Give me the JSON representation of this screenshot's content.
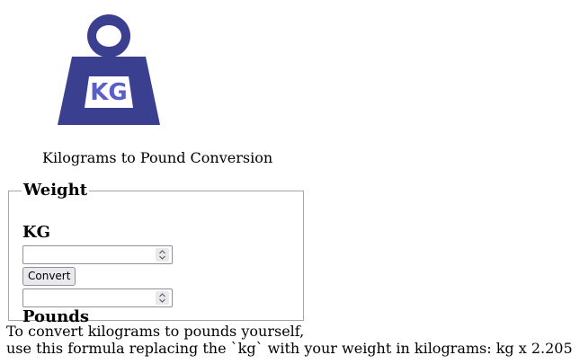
{
  "logo": {
    "text": "KG",
    "color": "#3b3f8f",
    "text_color": "#5a5fc8"
  },
  "subtitle": "Kilograms to Pound Conversion",
  "form": {
    "legend": "Weight",
    "kg_label": "KG",
    "kg_value": "",
    "convert_button": "Convert",
    "pounds_value": "",
    "pounds_label": "Pounds"
  },
  "note": {
    "line1": "To convert kilograms to pounds yourself,",
    "line2": "use this formula replacing the `kg` with your weight in kilograms: kg x 2.205"
  }
}
